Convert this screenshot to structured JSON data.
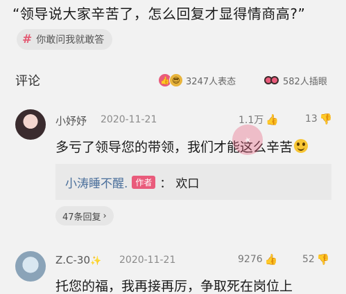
{
  "question": {
    "title": "“领导说大家辛苦了，怎么回复才显得情商高?”"
  },
  "tag": {
    "icon": "hashtag-icon",
    "label": "你敢问我就敢答"
  },
  "comments_header": {
    "title": "评论",
    "reactions_count": "3247人表态",
    "views_count": "582人插眼"
  },
  "comments": [
    {
      "username": "小妤妤",
      "date": "2020-11-21",
      "likes": "1.1万",
      "replies": "13",
      "text": "多亏了领导您的带领，我们才能这么辛苦",
      "reply": {
        "name": "小涛睡不醒.",
        "badge": "作者",
        "separator": "：",
        "text": "欢口"
      },
      "more_replies": "47条回复"
    },
    {
      "username": "Z.C-30",
      "date": "2020-11-21",
      "likes": "9276",
      "replies": "52",
      "text": "托您的福，我再接再厉，争取死在岗位上"
    }
  ],
  "colors": {
    "accent": "#e95b7b",
    "link": "#4a6f9b",
    "background": "#f2f2f2"
  }
}
